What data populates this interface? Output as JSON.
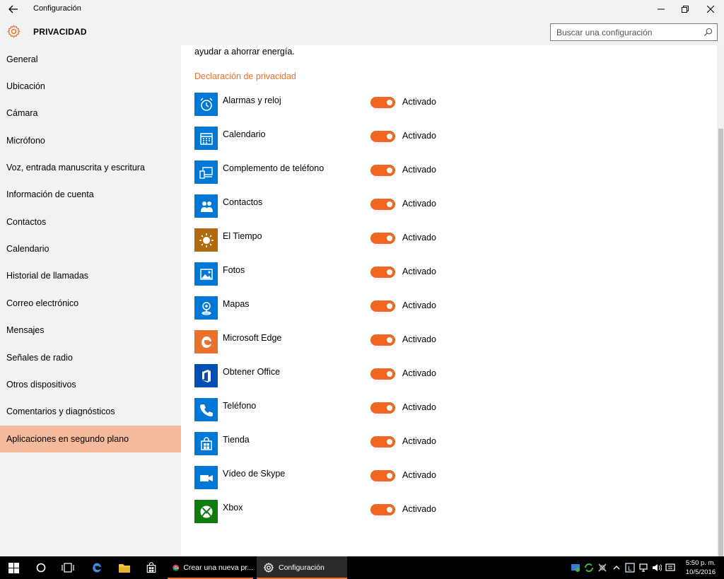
{
  "window": {
    "title": "Configuración",
    "back_icon": "back-arrow-icon",
    "controls": {
      "minimize": "—",
      "restore": "❐",
      "close": "✕"
    }
  },
  "header": {
    "section_title": "PRIVACIDAD",
    "search_placeholder": "Buscar una configuración"
  },
  "sidebar": {
    "items": [
      {
        "label": "General"
      },
      {
        "label": "Ubicación"
      },
      {
        "label": "Cámara"
      },
      {
        "label": "Micrófono"
      },
      {
        "label": "Voz, entrada manuscrita y escritura"
      },
      {
        "label": "Información de cuenta"
      },
      {
        "label": "Contactos"
      },
      {
        "label": "Calendario"
      },
      {
        "label": "Historial de llamadas"
      },
      {
        "label": "Correo electrónico"
      },
      {
        "label": "Mensajes"
      },
      {
        "label": "Señales de radio"
      },
      {
        "label": "Otros dispositivos"
      },
      {
        "label": "Comentarios y diagnósticos"
      },
      {
        "label": "Aplicaciones en segundo plano",
        "active": true
      }
    ]
  },
  "content": {
    "intro_text": "ayudar a ahorrar energía.",
    "privacy_link": "Declaración de privacidad",
    "apps": [
      {
        "name": "Alarmas y reloj",
        "state": "Activado",
        "icon": "alarm-clock-icon",
        "color": "#0078d7"
      },
      {
        "name": "Calendario",
        "state": "Activado",
        "icon": "calendar-icon",
        "color": "#0078d7"
      },
      {
        "name": "Complemento de teléfono",
        "state": "Activado",
        "icon": "phone-companion-icon",
        "color": "#0078d7"
      },
      {
        "name": "Contactos",
        "state": "Activado",
        "icon": "people-icon",
        "color": "#0078d7"
      },
      {
        "name": "El Tiempo",
        "state": "Activado",
        "icon": "weather-sun-icon",
        "color": "#b06a10"
      },
      {
        "name": "Fotos",
        "state": "Activado",
        "icon": "photos-icon",
        "color": "#0078d7"
      },
      {
        "name": "Mapas",
        "state": "Activado",
        "icon": "maps-icon",
        "color": "#0078d7"
      },
      {
        "name": "Microsoft Edge",
        "state": "Activado",
        "icon": "edge-icon",
        "color": "#e8702a"
      },
      {
        "name": "Obtener Office",
        "state": "Activado",
        "icon": "office-icon",
        "color": "#0050b3"
      },
      {
        "name": "Teléfono",
        "state": "Activado",
        "icon": "phone-icon",
        "color": "#0078d7"
      },
      {
        "name": "Tienda",
        "state": "Activado",
        "icon": "store-icon",
        "color": "#0078d7"
      },
      {
        "name": "Vídeo de Skype",
        "state": "Activado",
        "icon": "skype-video-icon",
        "color": "#0078d7"
      },
      {
        "name": "Xbox",
        "state": "Activado",
        "icon": "xbox-icon",
        "color": "#107c10"
      }
    ]
  },
  "taskbar": {
    "apps": [
      {
        "label": "Crear una nueva pr...",
        "icon": "chrome-icon"
      },
      {
        "label": "Configuración",
        "icon": "gear-icon"
      }
    ],
    "clock": {
      "time": "5:50 p. m.",
      "date": "10/5/2016"
    }
  },
  "colors": {
    "accent": "#f26522",
    "accent_text": "#e8702a",
    "sidebar_active": "#f5b99b",
    "chrome_bg": "#f2f2f2"
  }
}
